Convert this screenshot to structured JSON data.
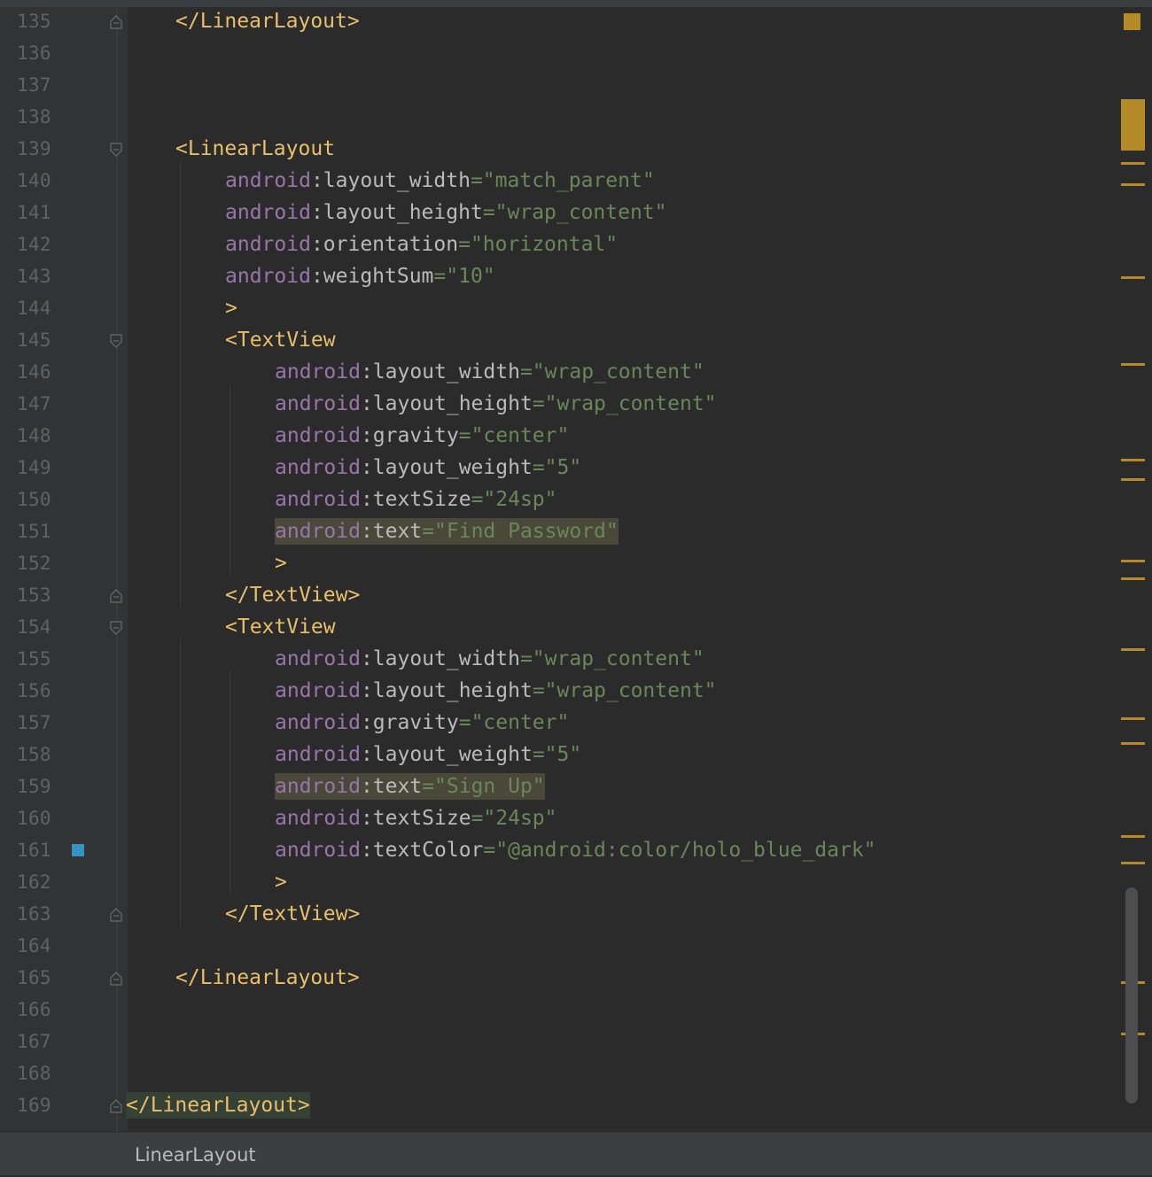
{
  "editor": {
    "lines": [
      {
        "n": "135",
        "fold": "end",
        "indent": 1,
        "tokens": [
          {
            "c": "t-tag",
            "t": "</LinearLayout>"
          }
        ]
      },
      {
        "n": "136",
        "indent": 0,
        "tokens": []
      },
      {
        "n": "137",
        "indent": 0,
        "tokens": []
      },
      {
        "n": "138",
        "indent": 0,
        "tokens": []
      },
      {
        "n": "139",
        "fold": "start",
        "indent": 1,
        "tokens": [
          {
            "c": "t-tag",
            "t": "<LinearLayout"
          }
        ]
      },
      {
        "n": "140",
        "indent": 2,
        "tokens": [
          {
            "c": "t-ns",
            "t": "android"
          },
          {
            "c": "t-attr",
            "t": ":layout_width"
          },
          {
            "c": "t-val",
            "t": "=\"match_parent\""
          }
        ]
      },
      {
        "n": "141",
        "indent": 2,
        "tokens": [
          {
            "c": "t-ns",
            "t": "android"
          },
          {
            "c": "t-attr",
            "t": ":layout_height"
          },
          {
            "c": "t-val",
            "t": "=\"wrap_content\""
          }
        ]
      },
      {
        "n": "142",
        "indent": 2,
        "tokens": [
          {
            "c": "t-ns",
            "t": "android"
          },
          {
            "c": "t-attr",
            "t": ":orientation"
          },
          {
            "c": "t-val",
            "t": "=\"horizontal\""
          }
        ]
      },
      {
        "n": "143",
        "indent": 2,
        "tokens": [
          {
            "c": "t-ns",
            "t": "android"
          },
          {
            "c": "t-attr",
            "t": ":weightSum"
          },
          {
            "c": "t-val",
            "t": "=\"10\""
          }
        ]
      },
      {
        "n": "144",
        "indent": 2,
        "tokens": [
          {
            "c": "t-tag",
            "t": ">"
          }
        ]
      },
      {
        "n": "145",
        "fold": "start",
        "indent": 2,
        "tokens": [
          {
            "c": "t-tag",
            "t": "<TextView"
          }
        ]
      },
      {
        "n": "146",
        "indent": 3,
        "tokens": [
          {
            "c": "t-ns",
            "t": "android"
          },
          {
            "c": "t-attr",
            "t": ":layout_width"
          },
          {
            "c": "t-val",
            "t": "=\"wrap_content\""
          }
        ]
      },
      {
        "n": "147",
        "indent": 3,
        "tokens": [
          {
            "c": "t-ns",
            "t": "android"
          },
          {
            "c": "t-attr",
            "t": ":layout_height"
          },
          {
            "c": "t-val",
            "t": "=\"wrap_content\""
          }
        ]
      },
      {
        "n": "148",
        "indent": 3,
        "tokens": [
          {
            "c": "t-ns",
            "t": "android"
          },
          {
            "c": "t-attr",
            "t": ":gravity"
          },
          {
            "c": "t-val",
            "t": "=\"center\""
          }
        ]
      },
      {
        "n": "149",
        "indent": 3,
        "tokens": [
          {
            "c": "t-ns",
            "t": "android"
          },
          {
            "c": "t-attr",
            "t": ":layout_weight"
          },
          {
            "c": "t-val",
            "t": "=\"5\""
          }
        ]
      },
      {
        "n": "150",
        "indent": 3,
        "tokens": [
          {
            "c": "t-ns",
            "t": "android"
          },
          {
            "c": "t-attr",
            "t": ":textSize"
          },
          {
            "c": "t-val",
            "t": "=\"24sp\""
          }
        ]
      },
      {
        "n": "151",
        "indent": 3,
        "highlight": "hl",
        "tokens": [
          {
            "c": "t-ns",
            "t": "android"
          },
          {
            "c": "t-attr",
            "t": ":text"
          },
          {
            "c": "t-val",
            "t": "=\"Find Password\""
          }
        ]
      },
      {
        "n": "152",
        "indent": 3,
        "tokens": [
          {
            "c": "t-tag",
            "t": ">"
          }
        ]
      },
      {
        "n": "153",
        "fold": "end",
        "indent": 2,
        "tokens": [
          {
            "c": "t-tag",
            "t": "</TextView>"
          }
        ]
      },
      {
        "n": "154",
        "fold": "start",
        "indent": 2,
        "tokens": [
          {
            "c": "t-tag",
            "t": "<TextView"
          }
        ]
      },
      {
        "n": "155",
        "indent": 3,
        "tokens": [
          {
            "c": "t-ns",
            "t": "android"
          },
          {
            "c": "t-attr",
            "t": ":layout_width"
          },
          {
            "c": "t-val",
            "t": "=\"wrap_content\""
          }
        ]
      },
      {
        "n": "156",
        "indent": 3,
        "tokens": [
          {
            "c": "t-ns",
            "t": "android"
          },
          {
            "c": "t-attr",
            "t": ":layout_height"
          },
          {
            "c": "t-val",
            "t": "=\"wrap_content\""
          }
        ]
      },
      {
        "n": "157",
        "indent": 3,
        "tokens": [
          {
            "c": "t-ns",
            "t": "android"
          },
          {
            "c": "t-attr",
            "t": ":gravity"
          },
          {
            "c": "t-val",
            "t": "=\"center\""
          }
        ]
      },
      {
        "n": "158",
        "indent": 3,
        "tokens": [
          {
            "c": "t-ns",
            "t": "android"
          },
          {
            "c": "t-attr",
            "t": ":layout_weight"
          },
          {
            "c": "t-val",
            "t": "=\"5\""
          }
        ]
      },
      {
        "n": "159",
        "indent": 3,
        "highlight": "hl",
        "tokens": [
          {
            "c": "t-ns",
            "t": "android"
          },
          {
            "c": "t-attr",
            "t": ":text"
          },
          {
            "c": "t-val",
            "t": "=\"Sign Up\""
          }
        ]
      },
      {
        "n": "160",
        "indent": 3,
        "tokens": [
          {
            "c": "t-ns",
            "t": "android"
          },
          {
            "c": "t-attr",
            "t": ":textSize"
          },
          {
            "c": "t-val",
            "t": "=\"24sp\""
          }
        ]
      },
      {
        "n": "161",
        "indent": 3,
        "bookmark": true,
        "tokens": [
          {
            "c": "t-ns",
            "t": "android"
          },
          {
            "c": "t-attr",
            "t": ":textColor"
          },
          {
            "c": "t-val",
            "t": "=\"@android:color/holo_blue_dark\""
          }
        ]
      },
      {
        "n": "162",
        "indent": 3,
        "tokens": [
          {
            "c": "t-tag",
            "t": ">"
          }
        ]
      },
      {
        "n": "163",
        "fold": "end",
        "indent": 2,
        "tokens": [
          {
            "c": "t-tag",
            "t": "</TextView>"
          }
        ]
      },
      {
        "n": "164",
        "indent": 0,
        "tokens": []
      },
      {
        "n": "165",
        "fold": "end",
        "indent": 1,
        "tokens": [
          {
            "c": "t-tag",
            "t": "</LinearLayout>"
          }
        ]
      },
      {
        "n": "166",
        "indent": 0,
        "tokens": []
      },
      {
        "n": "167",
        "indent": 0,
        "tokens": []
      },
      {
        "n": "168",
        "indent": 0,
        "tokens": []
      },
      {
        "n": "169",
        "fold": "end",
        "indent": 0,
        "highlight": "hl2",
        "tokens": [
          {
            "c": "t-tag",
            "t": "</LinearLayout>"
          }
        ]
      }
    ]
  },
  "status": {
    "breadcrumb": "LinearLayout"
  },
  "colors": {
    "background": "#2b2b2b",
    "tag": "#e8bf6a",
    "namespace": "#9876aa",
    "value": "#6a8759",
    "marker": "#b58b2a",
    "bookmark": "#3592c4"
  }
}
